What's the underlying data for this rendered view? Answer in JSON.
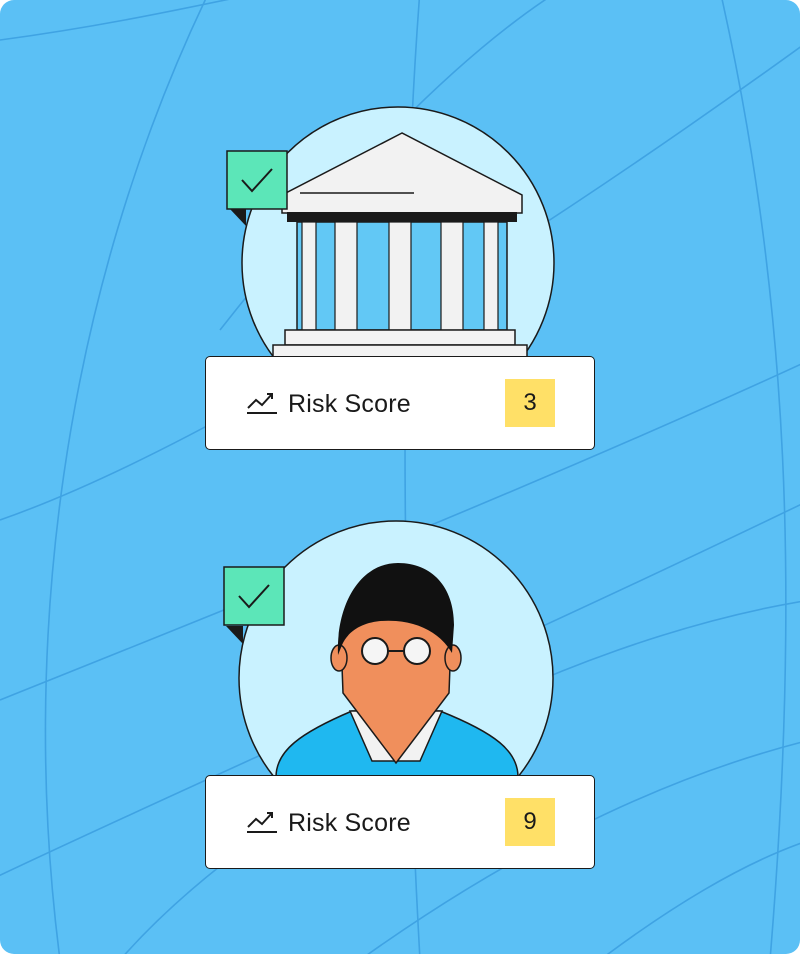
{
  "colors": {
    "background": "#5bc0f5",
    "background_lines": "#3b9ee0",
    "circle_fill": "#c9f2ff",
    "check_badge": "#5ce6b8",
    "score_badge": "#ffe067",
    "skin": "#f08f5c",
    "shirt": "#1fb8f0"
  },
  "cards": [
    {
      "subject": "institution",
      "icon": "bank-building-icon",
      "verified_icon": "check-badge-icon",
      "label": "Risk Score",
      "score": "3"
    },
    {
      "subject": "individual",
      "icon": "person-avatar-icon",
      "verified_icon": "check-badge-icon",
      "label": "Risk Score",
      "score": "9"
    }
  ]
}
